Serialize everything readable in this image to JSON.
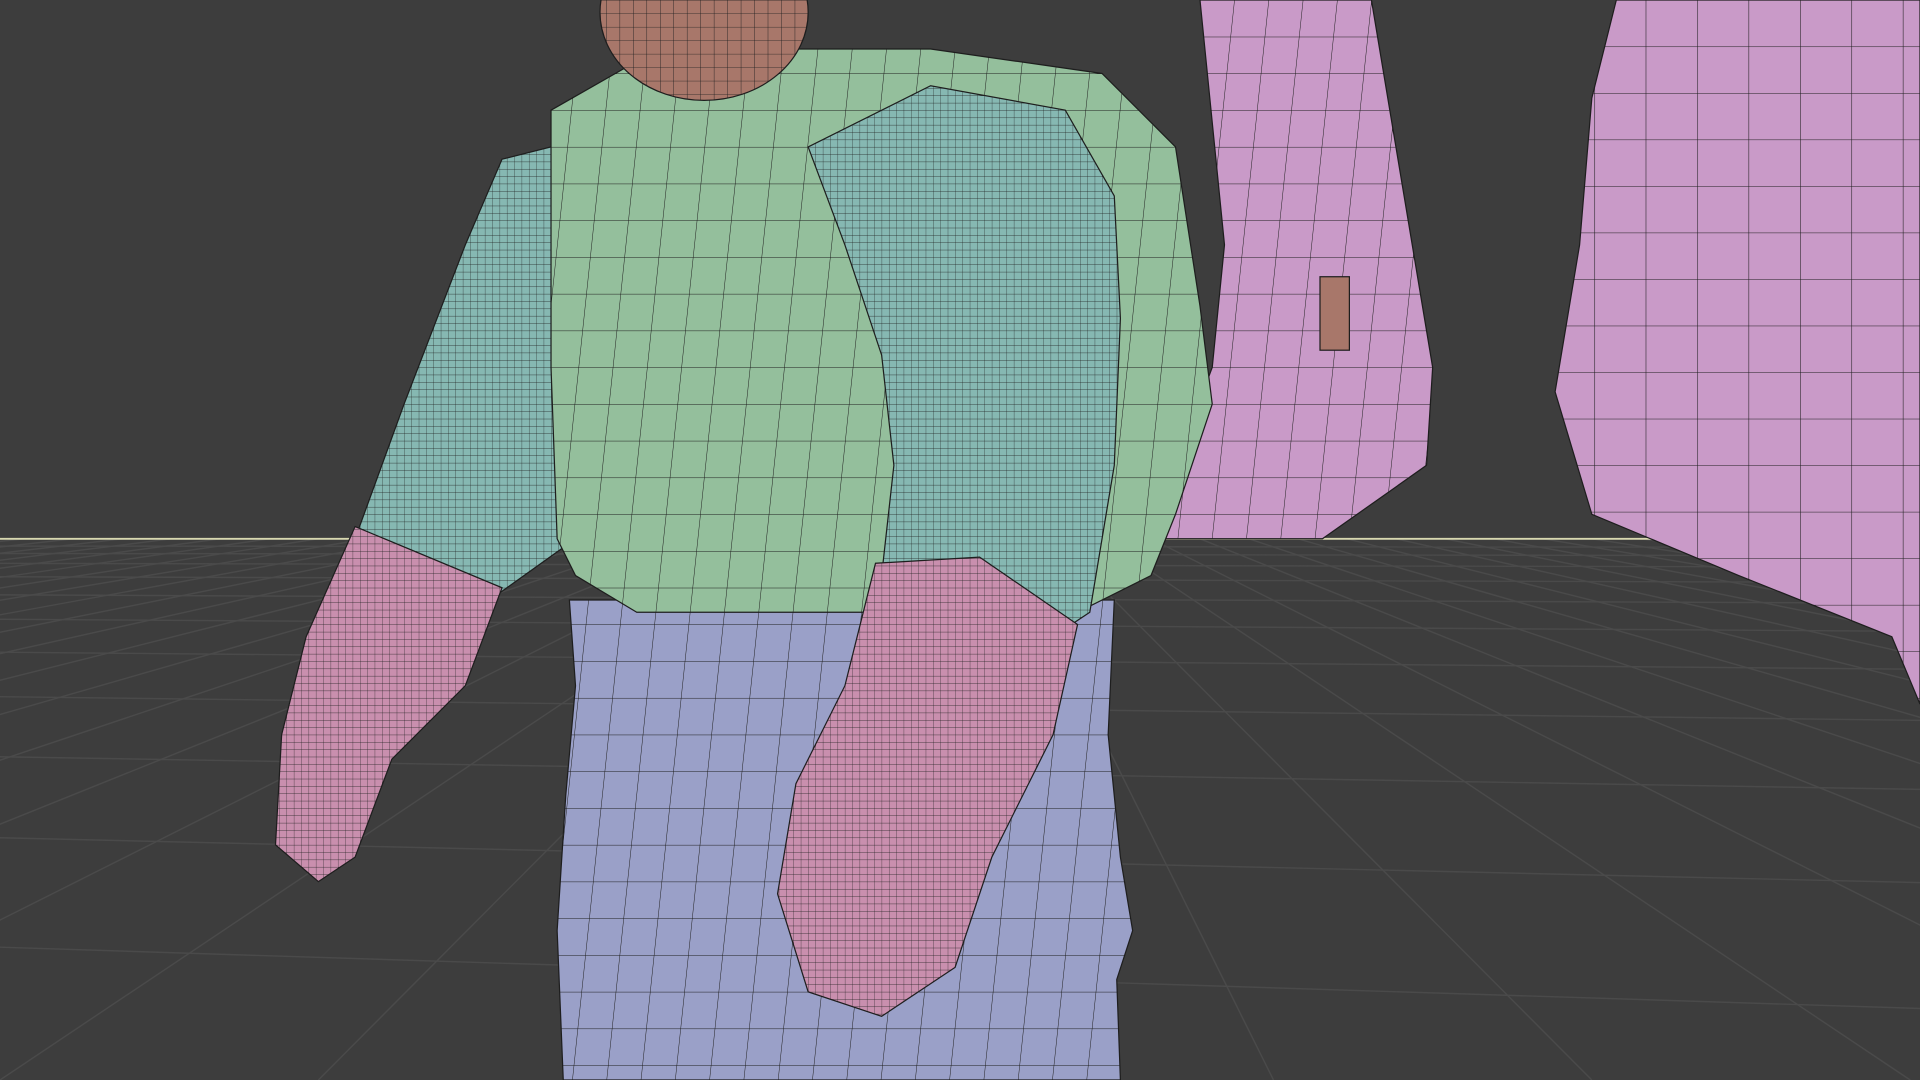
{
  "viewport": {
    "background": "#3d3d3d",
    "floor_grid": "#4a4a4a",
    "horizon_line": "#d8d8b0"
  },
  "model": {
    "colors": {
      "head": "#a8776a",
      "vest": "#94bf9c",
      "sleeves": "#86b8b2",
      "gloves": "#c98fae",
      "pants": "#9aa0c8",
      "backpack": "#c99ac8",
      "right_object": "#c99ac8",
      "wireframe": "#1e1e1e"
    }
  }
}
